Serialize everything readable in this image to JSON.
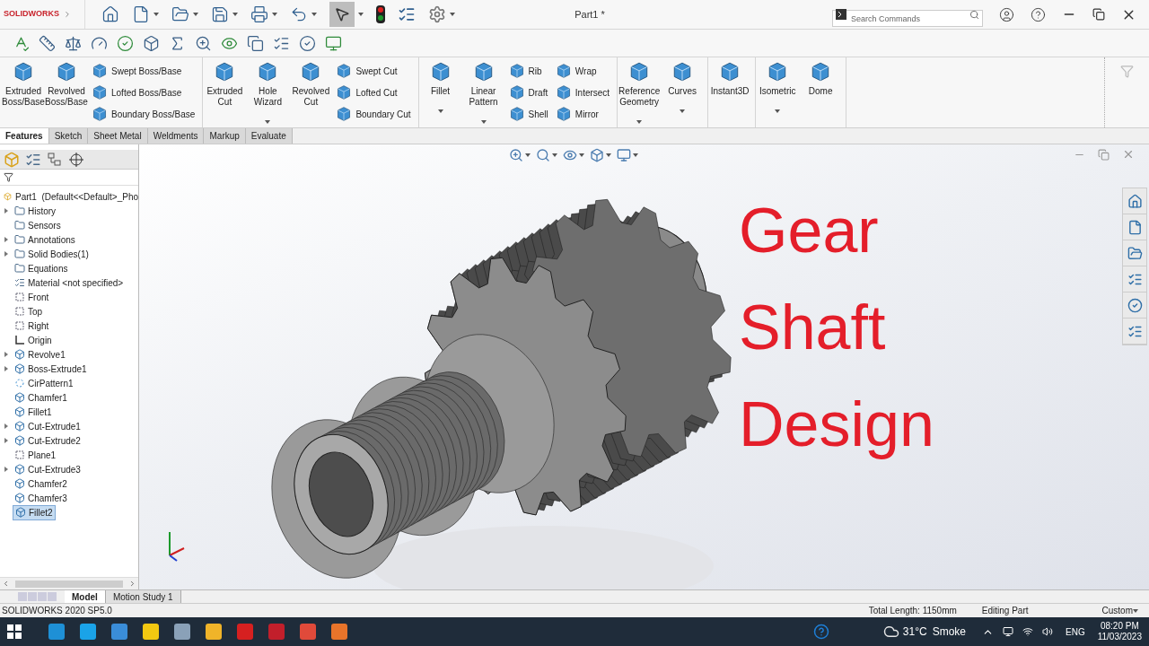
{
  "app": {
    "logo": "SOLIDWORKS",
    "document_title": "Part1 *"
  },
  "search": {
    "placeholder": "Search Commands"
  },
  "ribbon": {
    "groups": [
      {
        "items": [
          {
            "kind": "large",
            "label": "Extruded Boss/Base",
            "dropdown": false
          },
          {
            "kind": "large",
            "label": "Revolved Boss/Base",
            "dropdown": false
          },
          {
            "kind": "stack",
            "labels": [
              "Swept Boss/Base",
              "Lofted Boss/Base",
              "Boundary Boss/Base"
            ]
          }
        ]
      },
      {
        "items": [
          {
            "kind": "large",
            "label": "Extruded Cut",
            "dropdown": false
          },
          {
            "kind": "large",
            "label": "Hole Wizard",
            "dropdown": true
          },
          {
            "kind": "large",
            "label": "Revolved Cut",
            "dropdown": false
          },
          {
            "kind": "stack",
            "labels": [
              "Swept Cut",
              "Lofted Cut",
              "Boundary Cut"
            ]
          }
        ]
      },
      {
        "items": [
          {
            "kind": "large",
            "label": "Fillet",
            "dropdown": true
          },
          {
            "kind": "large",
            "label": "Linear Pattern",
            "dropdown": true
          },
          {
            "kind": "stack",
            "labels": [
              "Rib",
              "Draft",
              "Shell"
            ]
          },
          {
            "kind": "stack",
            "labels": [
              "Wrap",
              "Intersect",
              "Mirror"
            ]
          }
        ]
      },
      {
        "items": [
          {
            "kind": "large",
            "label": "Reference Geometry",
            "dropdown": true
          },
          {
            "kind": "large",
            "label": "Curves",
            "dropdown": true
          }
        ]
      },
      {
        "items": [
          {
            "kind": "large",
            "label": "Instant3D",
            "dropdown": false
          }
        ]
      },
      {
        "items": [
          {
            "kind": "large",
            "label": "Isometric",
            "dropdown": true
          },
          {
            "kind": "large",
            "label": "Dome",
            "dropdown": false
          }
        ]
      }
    ]
  },
  "tabs": [
    {
      "label": "Features",
      "selected": true
    },
    {
      "label": "Sketch",
      "selected": false
    },
    {
      "label": "Sheet Metal",
      "selected": false
    },
    {
      "label": "Weldments",
      "selected": false
    },
    {
      "label": "Markup",
      "selected": false
    },
    {
      "label": "Evaluate",
      "selected": false
    }
  ],
  "tree": {
    "root": "Part1  (Default<<Default>_Pho",
    "items": [
      {
        "label": "History",
        "kind": "folder",
        "expandable": true,
        "selected": false
      },
      {
        "label": "Sensors",
        "kind": "folder",
        "expandable": false,
        "selected": false
      },
      {
        "label": "Annotations",
        "kind": "folder",
        "expandable": true,
        "selected": false
      },
      {
        "label": "Solid Bodies(1)",
        "kind": "folder",
        "expandable": true,
        "selected": false
      },
      {
        "label": "Equations",
        "kind": "folder",
        "expandable": false,
        "selected": false
      },
      {
        "label": "Material <not specified>",
        "kind": "material",
        "expandable": false,
        "selected": false
      },
      {
        "label": "Front",
        "kind": "plane",
        "expandable": false,
        "selected": false
      },
      {
        "label": "Top",
        "kind": "plane",
        "expandable": false,
        "selected": false
      },
      {
        "label": "Right",
        "kind": "plane",
        "expandable": false,
        "selected": false
      },
      {
        "label": "Origin",
        "kind": "origin",
        "expandable": false,
        "selected": false
      },
      {
        "label": "Revolve1",
        "kind": "feature",
        "expandable": true,
        "selected": false
      },
      {
        "label": "Boss-Extrude1",
        "kind": "feature",
        "expandable": true,
        "selected": false
      },
      {
        "label": "CirPattern1",
        "kind": "pattern",
        "expandable": false,
        "selected": false
      },
      {
        "label": "Chamfer1",
        "kind": "feature",
        "expandable": false,
        "selected": false
      },
      {
        "label": "Fillet1",
        "kind": "feature",
        "expandable": false,
        "selected": false
      },
      {
        "label": "Cut-Extrude1",
        "kind": "feature",
        "expandable": true,
        "selected": false
      },
      {
        "label": "Cut-Extrude2",
        "kind": "feature",
        "expandable": true,
        "selected": false
      },
      {
        "label": "Plane1",
        "kind": "plane",
        "expandable": false,
        "selected": false
      },
      {
        "label": "Cut-Extrude3",
        "kind": "feature",
        "expandable": true,
        "selected": false
      },
      {
        "label": "Chamfer2",
        "kind": "feature",
        "expandable": false,
        "selected": false
      },
      {
        "label": "Chamfer3",
        "kind": "feature",
        "expandable": false,
        "selected": false
      },
      {
        "label": "Fillet2",
        "kind": "feature",
        "expandable": false,
        "selected": true
      }
    ]
  },
  "viewport": {
    "overlay_title": [
      "Gear",
      "Shaft",
      "Design"
    ]
  },
  "bottom_tabs": [
    {
      "label": "Model",
      "selected": true
    },
    {
      "label": "Motion Study 1",
      "selected": false
    }
  ],
  "status_bar": {
    "version": "SOLIDWORKS 2020 SP5.0",
    "total_length": "Total Length: 1150mm",
    "mode": "Editing Part",
    "units": "Custom"
  },
  "taskbar": {
    "temperature": "31°C",
    "weather": "Smoke",
    "language": "ENG",
    "time": "08:20 PM",
    "date": "11/03/2023"
  }
}
